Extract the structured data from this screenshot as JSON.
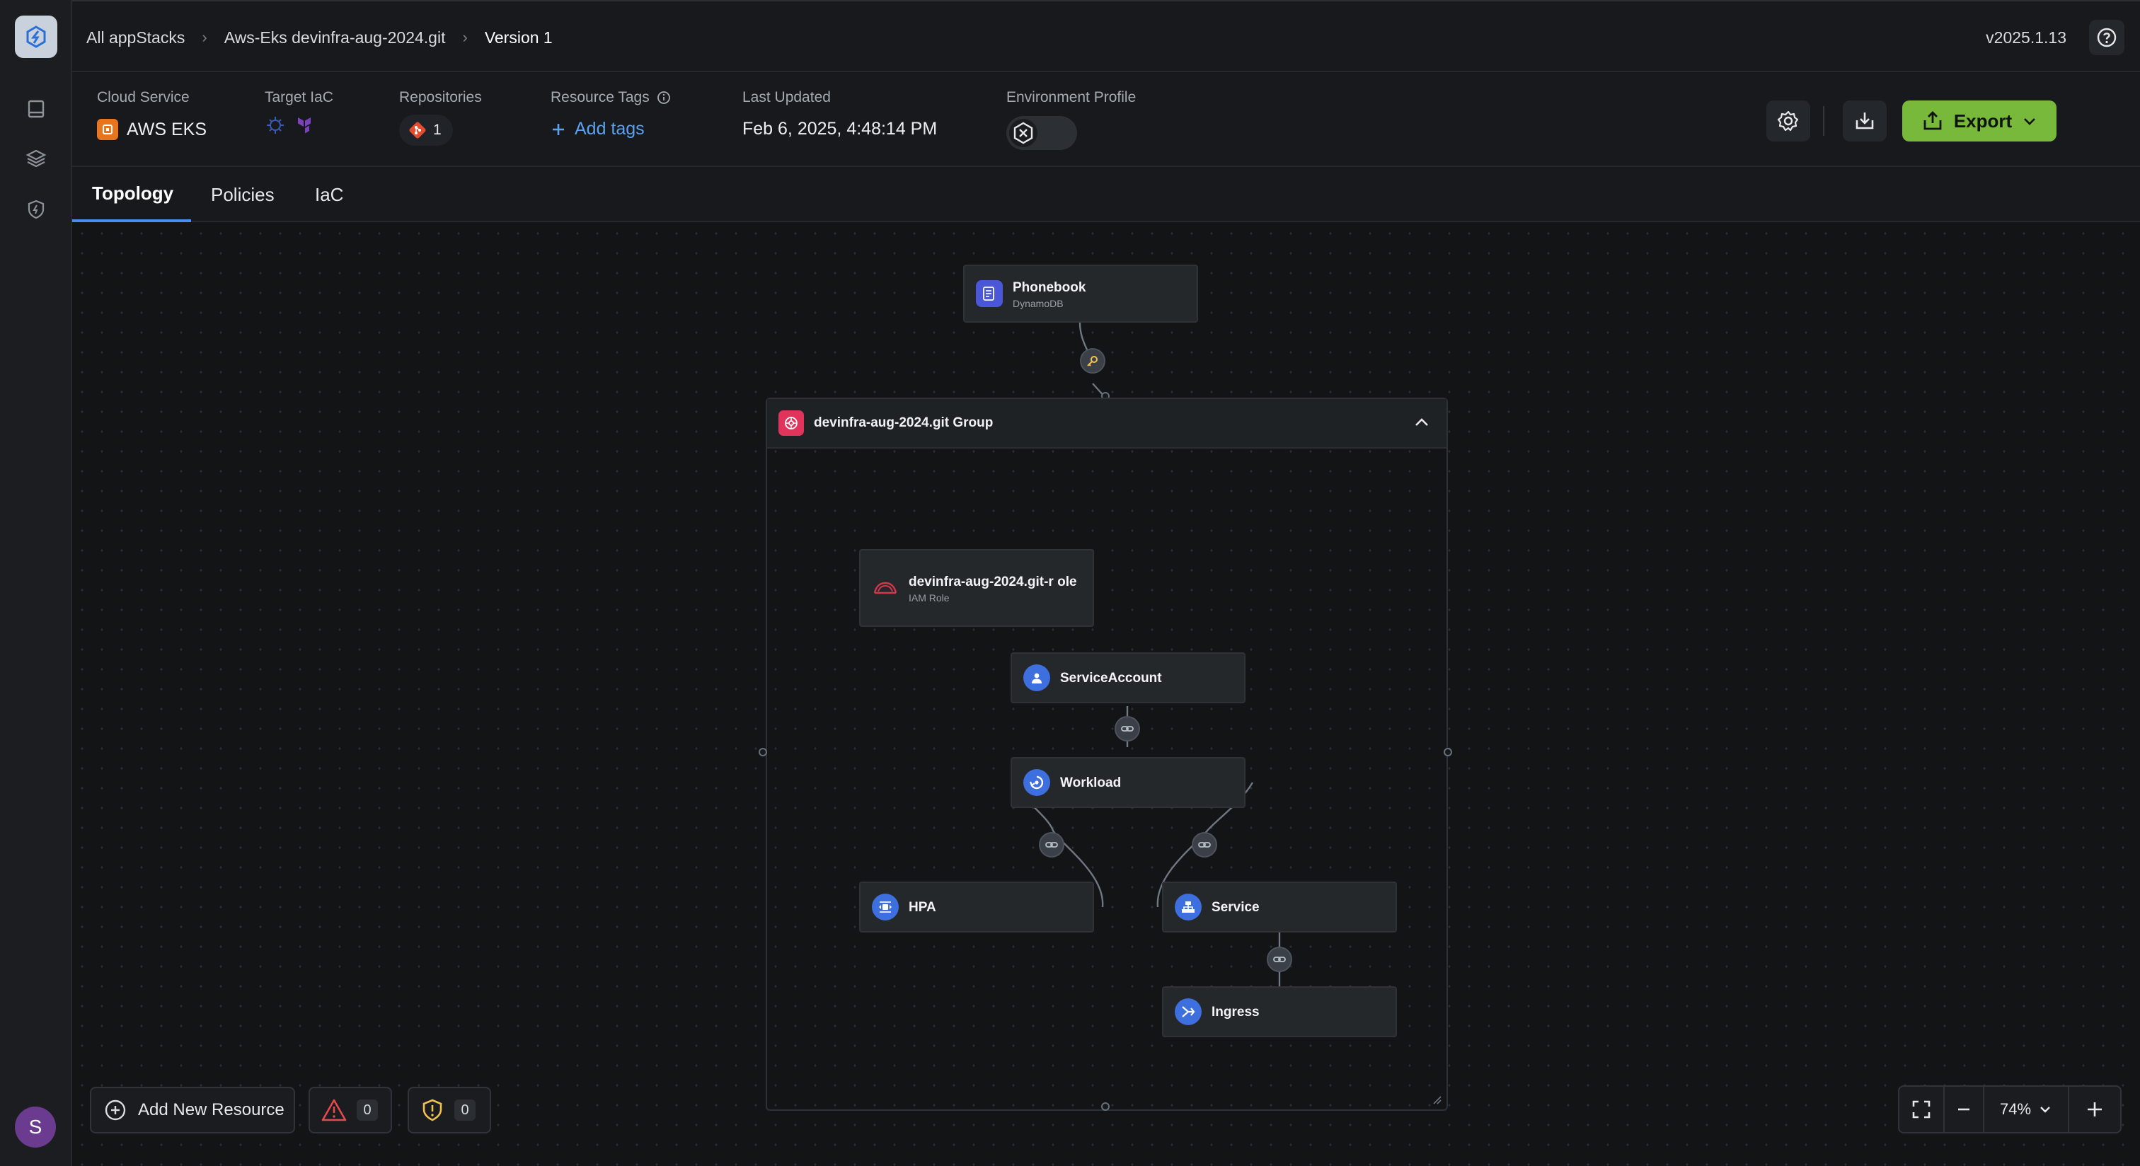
{
  "breadcrumbs": [
    "All appStacks",
    "Aws-Eks devinfra-aug-2024.git",
    "Version 1"
  ],
  "version": "v2025.1.13",
  "user_initial": "S",
  "info": {
    "cloud_service": {
      "label": "Cloud Service",
      "value": "AWS EKS"
    },
    "target_iac": {
      "label": "Target IaC",
      "icons": [
        "helm-icon",
        "terraform-icon"
      ]
    },
    "repositories": {
      "label": "Repositories",
      "count": "1"
    },
    "resource_tags": {
      "label": "Resource Tags",
      "action": "Add tags"
    },
    "last_updated": {
      "label": "Last Updated",
      "value": "Feb 6, 2025, 4:48:14 PM"
    },
    "environment_profile": {
      "label": "Environment Profile"
    }
  },
  "export_label": "Export",
  "tabs": [
    "Topology",
    "Policies",
    "IaC"
  ],
  "active_tab": "Topology",
  "topology": {
    "group": {
      "title": "devinfra-aug-2024.git Group"
    },
    "nodes": {
      "phonebook": {
        "title": "Phonebook",
        "subtitle": "DynamoDB"
      },
      "iam_role": {
        "title": "devinfra-aug-2024.git-r ole",
        "subtitle": "IAM Role"
      },
      "service_account": {
        "title": "ServiceAccount"
      },
      "workload": {
        "title": "Workload"
      },
      "hpa": {
        "title": "HPA"
      },
      "service": {
        "title": "Service"
      },
      "ingress": {
        "title": "Ingress"
      }
    }
  },
  "bottom": {
    "add_resource": "Add New Resource",
    "errors": "0",
    "warnings": "0",
    "zoom": "74%"
  },
  "colors": {
    "accent": "#4a8ef0",
    "export": "#78b83a",
    "aws": "#e8741c",
    "group": "#e0345c",
    "k8s": "#3d6fde"
  }
}
